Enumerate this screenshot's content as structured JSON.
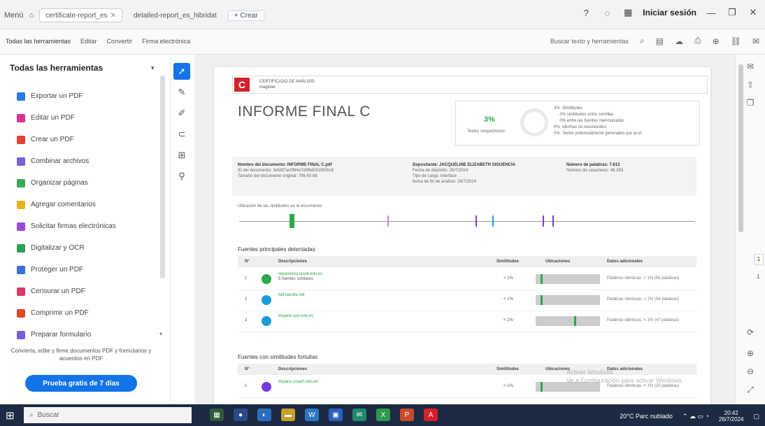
{
  "titlebar": {
    "menu_label": "Menú",
    "tabs": [
      {
        "label": "certificate-report_es"
      },
      {
        "label": "detailed-report_es_hibridat"
      }
    ],
    "new_tab_label": "+ Crear",
    "signin_label": "Iniciar sesión",
    "window_controls": {
      "minimize": "—",
      "maximize": "❐",
      "close": "✕"
    }
  },
  "toolbar": {
    "tabs": [
      "Todas las herramientas",
      "Editar",
      "Convertir",
      "Firma electrónica"
    ],
    "search_all_label": "Buscar texto y herramientas"
  },
  "leftpanel": {
    "title": "Todas las herramientas",
    "items": [
      {
        "label": "Exportar un PDF",
        "color": "#2c7be5"
      },
      {
        "label": "Editar un PDF",
        "color": "#d9338f"
      },
      {
        "label": "Crear un PDF",
        "color": "#e0413b"
      },
      {
        "label": "Combinar archivos",
        "color": "#7a60d8"
      },
      {
        "label": "Organizar páginas",
        "color": "#3ea85a"
      },
      {
        "label": "Agregar comentarios",
        "color": "#e8b21f"
      },
      {
        "label": "Solicitar firmas electrónicas",
        "color": "#9a4ad9"
      },
      {
        "label": "Digitalizar y OCR",
        "color": "#2e9f57"
      },
      {
        "label": "Proteger un PDF",
        "color": "#3b6ed6"
      },
      {
        "label": "Censurar un PDF",
        "color": "#d73a6b"
      },
      {
        "label": "Comprimir un PDF",
        "color": "#e04a2c"
      },
      {
        "label": "Preparar formulario",
        "color": "#7a60d8"
      }
    ],
    "promo_text": "Convierta, edite y firme documentos PDF y formularios y acuerdos en PDF",
    "promo_button": "Prueba gratis de 7 días"
  },
  "vstrip": {
    "tools": [
      "select-tool",
      "comment-tool",
      "draw-tool",
      "link-tool",
      "insert-tool",
      "stamp-tool"
    ]
  },
  "document": {
    "org_line1": "CERTIFICADO DE ANÁLISIS",
    "org_line2": "magister",
    "title": "INFORME FINAL C",
    "similarity_percent": "3%",
    "similarity_label": "Textos sospechosos",
    "legend": [
      "3%  Similitudes",
      "     0% similitudes entre comillas",
      "     0% entre las fuentes mencionadas",
      "0%  Idiomas no reconocidos",
      "0%  Textos potencialmente generados por la IA"
    ],
    "meta": [
      {
        "title": "Nombre del documento: INFORME FINAL C.pdf",
        "lines": [
          "ID del documento: 3e58f7ac0f64e7d0fbd0026f2b18",
          "Tamaño del documento original: 796,43 kB"
        ]
      },
      {
        "title": "Depositante: JACQUELINE ELIZABETH SIGUENCIA",
        "lines": [
          "Fecha de depósito: 26/7/2024",
          "Tipo de carga: interface",
          "fecha de fin de análisis: 26/7/2024"
        ]
      },
      {
        "title": "Número de palabras: 7.613",
        "lines": [
          "Número de caracteres: 48.283"
        ]
      }
    ],
    "distribution_label": "Ubicación de las similitudes en el documento:",
    "section1_title": "Fuentes principales detectadas",
    "section2_title": "Fuentes con similitudes fortuitas",
    "table_headers": {
      "num": "N°",
      "desc": "Descripciones",
      "sim": "Similitudes",
      "loc": "Ubicaciones",
      "extra": "Datos adicionales"
    },
    "sources": [
      {
        "num": "1",
        "src": "repositorio.uisek.edu.ec",
        "line2": "5 fuentes similares",
        "pct": "< 1%",
        "extra": "Palabras idénticas: < 1% (55 palabras)",
        "color": "#2aa84a",
        "mark": 0.08
      },
      {
        "num": "2",
        "src": "hdl.handle.net",
        "line2": "",
        "pct": "< 1%",
        "extra": "Palabras idénticas: < 1% (54 palabras)",
        "color": "#1e9bd7",
        "mark": 0.08
      },
      {
        "num": "3",
        "src": "dspace.ups.edu.ec",
        "line2": "",
        "pct": "< 1%",
        "extra": "Palabras idénticas: < 1% (47 palabras)",
        "color": "#1e9bd7",
        "mark": 0.6
      }
    ],
    "fortuitous": [
      {
        "num": "1",
        "src": "dspace.unach.edu.ec",
        "pct": "< 1%",
        "extra": "Palabras idénticas: < 1% (20 palabras)",
        "color": "#7a3ad9"
      }
    ]
  },
  "rightpanel": {
    "page_current": "1",
    "page_total": "1"
  },
  "watermark": {
    "line1": "Activar Windows",
    "line2": "Ve a Configuración para activar Windows."
  },
  "taskbar": {
    "search_placeholder": "Buscar",
    "weather": "20°C Parc nublado",
    "time": "20:42",
    "date": "26/7/2024"
  }
}
